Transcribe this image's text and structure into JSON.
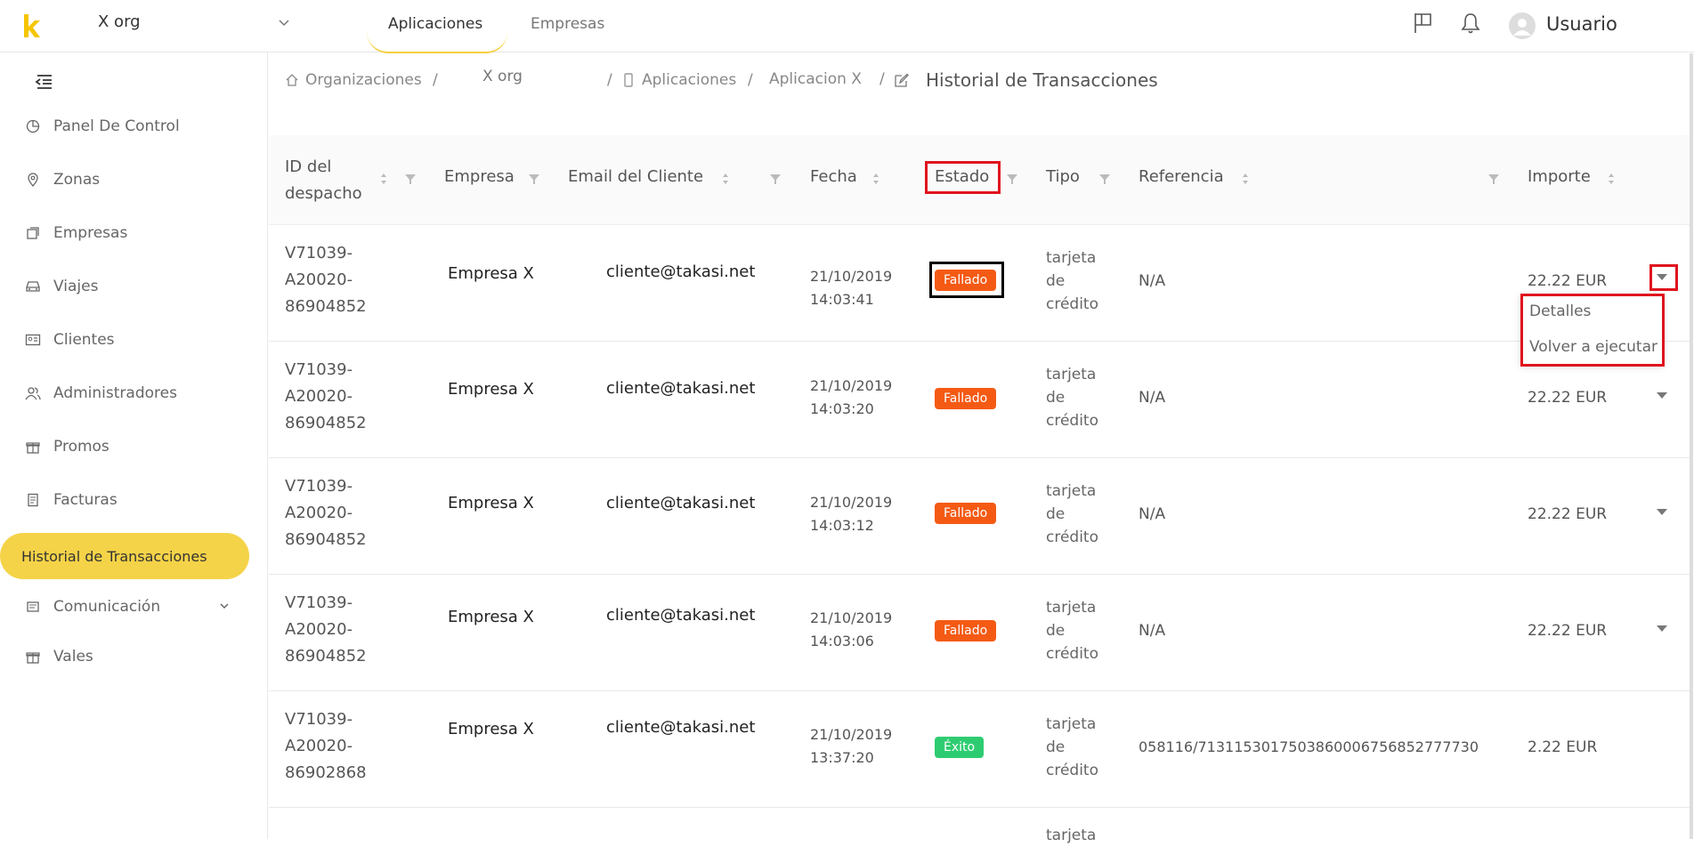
{
  "header": {
    "org": "X org",
    "tabs": [
      "Aplicaciones",
      "Empresas"
    ],
    "user": "Usuario"
  },
  "sidebar": {
    "items": [
      "Panel De Control",
      "Zonas",
      "Empresas",
      "Viajes",
      "Clientes",
      "Administradores",
      "Promos",
      "Facturas",
      "Historial de Transacciones",
      "Comunicación",
      "Vales"
    ],
    "active": "Historial de Transacciones"
  },
  "breadcrumb": {
    "org_label": "Organizaciones",
    "org": "X org",
    "apps": "Aplicaciones",
    "app": "Aplicacion X",
    "page": "Historial de Transacciones"
  },
  "table": {
    "columns": [
      "ID del despacho",
      "Empresa",
      "Email del Cliente",
      "Fecha",
      "Estado",
      "Tipo",
      "Referencia",
      "Importe"
    ],
    "rows": [
      {
        "id": [
          "V71039-",
          "A20020-",
          "86904852"
        ],
        "empresa": "Empresa X",
        "email": "cliente@takasi.net",
        "fecha": [
          "21/10/2019",
          "14:03:41"
        ],
        "estado": "Fallado",
        "tipo": [
          "tarjeta",
          "de",
          "crédito"
        ],
        "ref": "N/A",
        "importe": "22.22 EUR"
      },
      {
        "id": [
          "V71039-",
          "A20020-",
          "86904852"
        ],
        "empresa": "Empresa X",
        "email": "cliente@takasi.net",
        "fecha": [
          "21/10/2019",
          "14:03:20"
        ],
        "estado": "Fallado",
        "tipo": [
          "tarjeta",
          "de",
          "crédito"
        ],
        "ref": "N/A",
        "importe": "22.22 EUR"
      },
      {
        "id": [
          "V71039-",
          "A20020-",
          "86904852"
        ],
        "empresa": "Empresa X",
        "email": "cliente@takasi.net",
        "fecha": [
          "21/10/2019",
          "14:03:12"
        ],
        "estado": "Fallado",
        "tipo": [
          "tarjeta",
          "de",
          "crédito"
        ],
        "ref": "N/A",
        "importe": "22.22 EUR"
      },
      {
        "id": [
          "V71039-",
          "A20020-",
          "86904852"
        ],
        "empresa": "Empresa X",
        "email": "cliente@takasi.net",
        "fecha": [
          "21/10/2019",
          "14:03:06"
        ],
        "estado": "Fallado",
        "tipo": [
          "tarjeta",
          "de",
          "crédito"
        ],
        "ref": "N/A",
        "importe": "22.22 EUR"
      },
      {
        "id": [
          "V71039-",
          "A20020-",
          "86902868"
        ],
        "empresa": "Empresa X",
        "email": "cliente@takasi.net",
        "fecha": [
          "21/10/2019",
          "13:37:20"
        ],
        "estado": "Éxito",
        "tipo": [
          "tarjeta",
          "de",
          "crédito"
        ],
        "ref": "058116/7131153017503860006756852777730",
        "importe": "2.22 EUR"
      }
    ],
    "partial_row": {
      "tipo": "tarjeta"
    }
  },
  "dropdown": {
    "items": [
      "Detalles",
      "Volver a ejecutar"
    ]
  },
  "colors": {
    "accent": "#f5d348",
    "fail": "#f45a14",
    "success": "#2ecc71",
    "highlight": "#e0141e"
  }
}
